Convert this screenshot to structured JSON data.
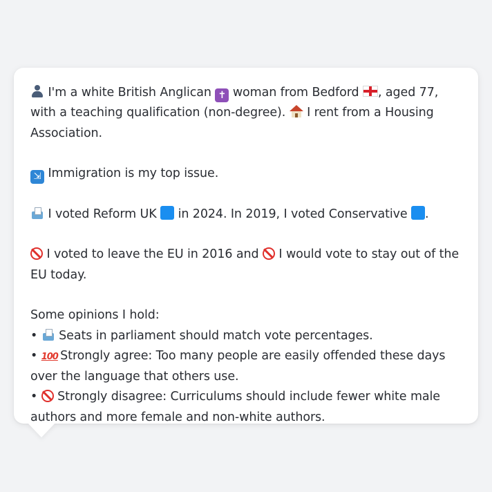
{
  "profile": {
    "line1_a": "I'm a white British Anglican",
    "line1_b": "woman from Bedford",
    "line1_c": ", aged 77, with a teaching qualification (non-degree).",
    "line1_d": "I rent from a Housing Association.",
    "issue": "Immigration is my top issue.",
    "vote_a": "I voted Reform UK",
    "vote_b": "in 2024. In 2019, I voted Conservative",
    "vote_c": ".",
    "eu_a": "I voted to leave the EU in 2016 and",
    "eu_b": "I would vote to stay out of the EU today.",
    "opinions_heading": "Some opinions I hold:",
    "opinions": [
      {
        "bullet": "•",
        "icon": "ballot-box-icon",
        "text": "Seats in parliament should match vote percentages."
      },
      {
        "bullet": "•",
        "icon": "hundred-points-icon",
        "text": "Strongly agree: Too many people are easily offended these days over the language that others use."
      },
      {
        "bullet": "•",
        "icon": "no-entry-icon",
        "text": "Strongly disagree: Curriculums should include fewer white male authors and more female and non-white authors."
      }
    ],
    "icons": {
      "cross_glyph": "✝",
      "immigration_glyph": "🛂",
      "hundred_glyph": "100"
    }
  }
}
